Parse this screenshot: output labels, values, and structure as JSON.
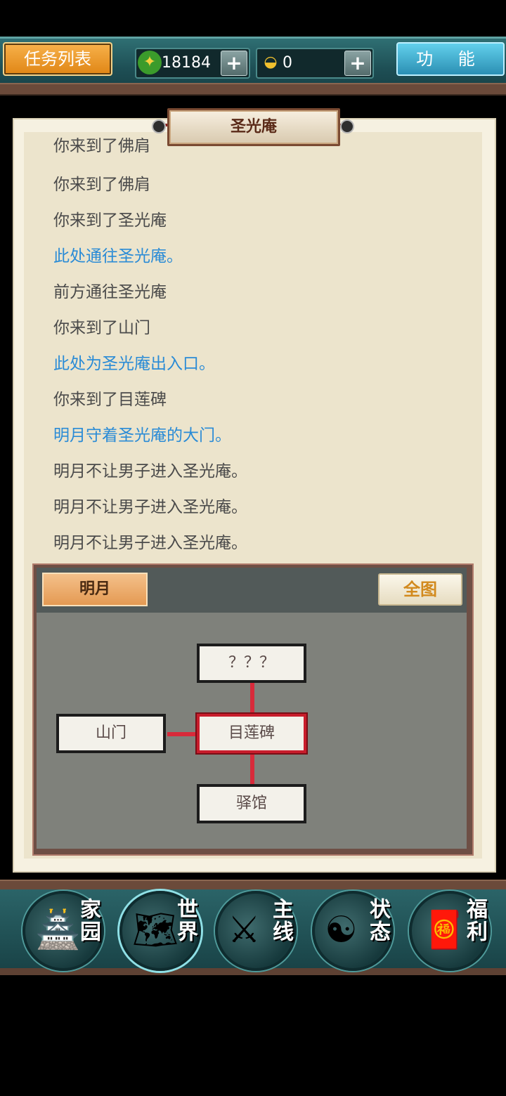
{
  "header": {
    "tasks_label": "任务列表",
    "function_label": "功 能",
    "currency": {
      "icon": "jade-coin-icon",
      "value": "18184",
      "plus": "+"
    },
    "gold": {
      "icon": "gold-ingot-icon",
      "value": "0",
      "plus": "+"
    }
  },
  "location": {
    "title": "圣光庵"
  },
  "log": [
    {
      "text": "你来到了佛肩",
      "color": "gray"
    },
    {
      "text": "你来到了佛肩",
      "color": "gray"
    },
    {
      "text": "你来到了圣光庵",
      "color": "gray"
    },
    {
      "text": "此处通往圣光庵。",
      "color": "blue"
    },
    {
      "text": "前方通往圣光庵",
      "color": "gray"
    },
    {
      "text": "你来到了山门",
      "color": "gray"
    },
    {
      "text": "此处为圣光庵出入口。",
      "color": "blue"
    },
    {
      "text": "你来到了目莲碑",
      "color": "gray"
    },
    {
      "text": "明月守着圣光庵的大门。",
      "color": "blue"
    },
    {
      "text": "明月不让男子进入圣光庵。",
      "color": "gray"
    },
    {
      "text": "明月不让男子进入圣光庵。",
      "color": "gray"
    },
    {
      "text": "明月不让男子进入圣光庵。",
      "color": "gray"
    }
  ],
  "map": {
    "npc_tab": "明月",
    "full_map_label": "全图",
    "nodes": {
      "north": "？？？",
      "west": "山门",
      "center": "目莲碑",
      "south": "驿馆"
    }
  },
  "nav": [
    {
      "label": "家园",
      "icon": "home-icon",
      "art": "🏯"
    },
    {
      "label": "世界",
      "icon": "world-map-icon",
      "art": "🗺",
      "active": true
    },
    {
      "label": "主线",
      "icon": "main-quest-icon",
      "art": "⚔"
    },
    {
      "label": "状态",
      "icon": "status-bagua-icon",
      "art": "☯"
    },
    {
      "label": "福利",
      "icon": "welfare-bag-icon",
      "art": "🧧"
    }
  ],
  "colors": {
    "accent_blue_text": "#2a8bd6",
    "current_node_border": "#c81d2c",
    "tasks_button": "#f0a030",
    "function_button": "#45b3d6"
  }
}
